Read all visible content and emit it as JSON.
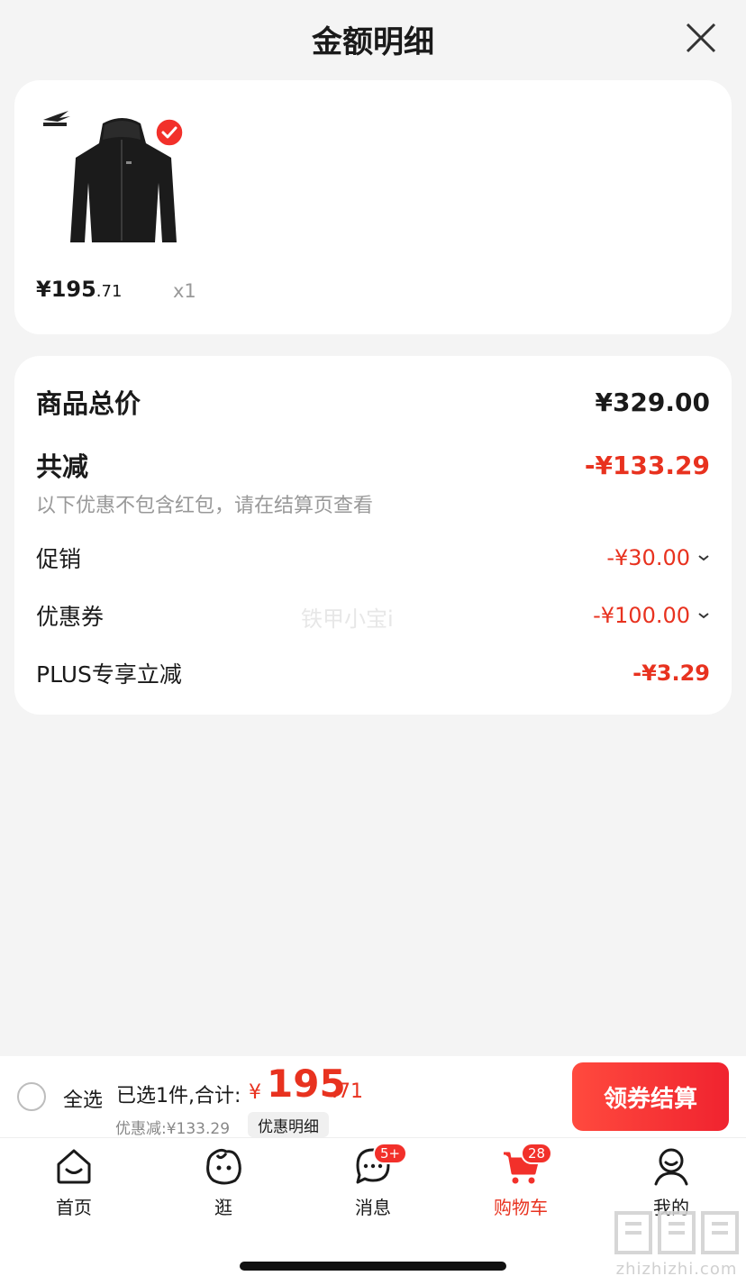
{
  "header": {
    "title": "金额明细"
  },
  "product": {
    "price_int": "¥195",
    "price_dec": ".71",
    "qty": "x1"
  },
  "summary": {
    "total_label": "商品总价",
    "total_value": "¥329.00",
    "reduce_label": "共减",
    "reduce_value": "-¥133.29",
    "hint": "以下优惠不包含红包，请在结算页查看",
    "promo_label": "促销",
    "promo_value": "-¥30.00",
    "coupon_label": "优惠券",
    "coupon_value": "-¥100.00",
    "plus_label": "PLUS专享立减",
    "plus_value": "-¥3.29",
    "watermark": "铁甲小宝i"
  },
  "bottom": {
    "select_all": "全选",
    "selected": "已选1件,合计:",
    "yen": "¥",
    "total_int": "195",
    "total_dec": ".71",
    "discount": "优惠减:¥133.29",
    "detail": "优惠明细",
    "checkout": "领券结算"
  },
  "tabs": [
    {
      "label": "首页",
      "icon": "home-icon"
    },
    {
      "label": "逛",
      "icon": "browse-face-icon"
    },
    {
      "label": "消息",
      "icon": "message-icon",
      "badge": "5+"
    },
    {
      "label": "购物车",
      "icon": "cart-icon",
      "badge": "28"
    },
    {
      "label": "我的",
      "icon": "user-icon"
    }
  ],
  "site_watermark": "zhizhizhi.com",
  "colors": {
    "accent": "#e8321f"
  }
}
